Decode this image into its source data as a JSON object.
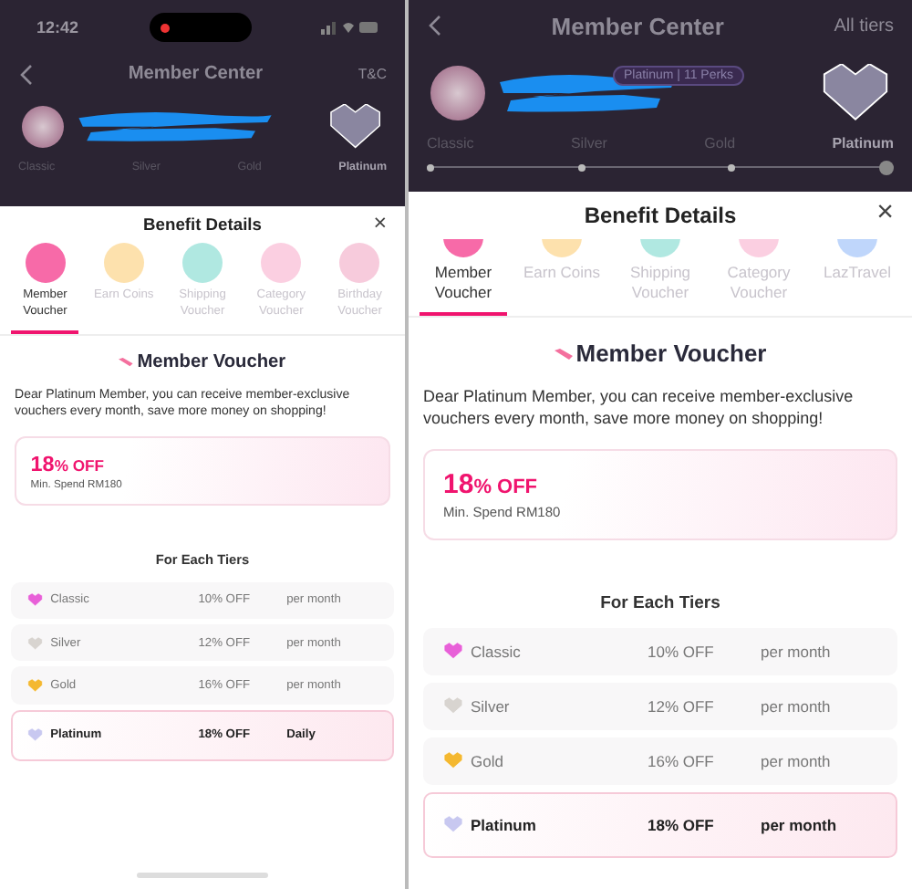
{
  "screens": [
    {
      "kind": "compact",
      "status_bar": {
        "time": "12:42"
      },
      "header": {
        "title": "Member Center",
        "action": "T&C"
      },
      "tiers": [
        {
          "label": "Classic",
          "selected": false
        },
        {
          "label": "Silver",
          "selected": false
        },
        {
          "label": "Gold",
          "selected": false
        },
        {
          "label": "Platinum",
          "selected": true
        }
      ],
      "sheet": {
        "title": "Benefit Details",
        "close": "×",
        "benefits": [
          {
            "label": "Member Voucher",
            "selected": true
          },
          {
            "label": "Earn Coins",
            "selected": false
          },
          {
            "label": "Shipping Voucher",
            "selected": false
          },
          {
            "label": "Category Voucher",
            "selected": false
          },
          {
            "label": "Birthday Voucher",
            "selected": false
          }
        ],
        "section_title": "Member Voucher",
        "description": "Dear Platinum Member, you can receive member-exclusive vouchers every month, save more money on shopping!",
        "voucher": {
          "amount": "18",
          "unit": "% OFF",
          "min_spend": "Min. Spend RM180"
        },
        "table_title": "For Each Tiers",
        "rows": [
          {
            "tier": "Classic",
            "discount": "10% OFF",
            "period": "per month",
            "selected": false,
            "color": "#e860d8"
          },
          {
            "tier": "Silver",
            "discount": "12% OFF",
            "period": "per month",
            "selected": false,
            "color": "#d8d4d0"
          },
          {
            "tier": "Gold",
            "discount": "16% OFF",
            "period": "per month",
            "selected": false,
            "color": "#f4b830"
          },
          {
            "tier": "Platinum",
            "discount": "18% OFF",
            "period": "Daily",
            "selected": true,
            "color": "#c8c8f0"
          }
        ]
      }
    },
    {
      "kind": "regular",
      "header": {
        "title": "Member Center",
        "action": "All tiers"
      },
      "badge": "Platinum | 11 Perks",
      "tiers": [
        {
          "label": "Classic",
          "selected": false
        },
        {
          "label": "Silver",
          "selected": false
        },
        {
          "label": "Gold",
          "selected": false
        },
        {
          "label": "Platinum",
          "selected": true
        }
      ],
      "sheet": {
        "title": "Benefit Details",
        "close": "×",
        "benefits": [
          {
            "label": "Member Voucher",
            "selected": true
          },
          {
            "label": "Earn Coins",
            "selected": false
          },
          {
            "label": "Shipping Voucher",
            "selected": false
          },
          {
            "label": "Category Voucher",
            "selected": false
          },
          {
            "label": "LazTravel",
            "selected": false
          }
        ],
        "section_title": "Member Voucher",
        "description": "Dear Platinum Member, you can receive member-exclusive vouchers every month, save more money on shopping!",
        "voucher": {
          "amount": "18",
          "unit": "% OFF",
          "min_spend": "Min. Spend RM180"
        },
        "table_title": "For Each Tiers",
        "rows": [
          {
            "tier": "Classic",
            "discount": "10% OFF",
            "period": "per month",
            "selected": false,
            "color": "#e860d8"
          },
          {
            "tier": "Silver",
            "discount": "12% OFF",
            "period": "per month",
            "selected": false,
            "color": "#d8d4d0"
          },
          {
            "tier": "Gold",
            "discount": "16% OFF",
            "period": "per month",
            "selected": false,
            "color": "#f4b830"
          },
          {
            "tier": "Platinum",
            "discount": "18% OFF",
            "period": "per month",
            "selected": true,
            "color": "#c8c8f0"
          }
        ]
      }
    }
  ]
}
